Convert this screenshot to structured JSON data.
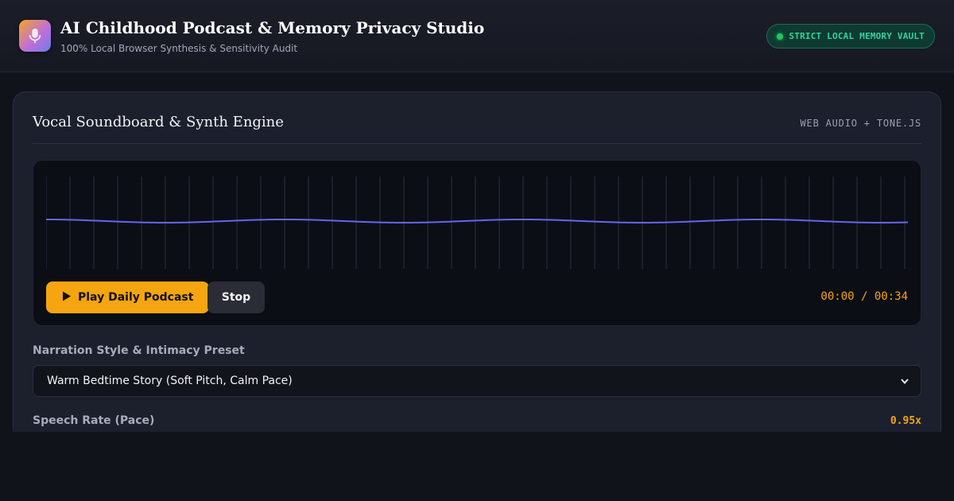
{
  "header": {
    "logo_icon": "microphone-icon",
    "title": "AI Childhood Podcast & Memory Privacy Studio",
    "subtitle": "100% Local Browser Synthesis & Sensitivity Audit",
    "badge": "STRICT LOCAL MEMORY VAULT"
  },
  "panel": {
    "title": "Vocal Soundboard & Synth Engine",
    "engine": "WEB AUDIO + TONE.JS",
    "player": {
      "play_label": "Play Daily Podcast",
      "play_icon": "play-icon",
      "stop_label": "Stop",
      "time": "00:00 / 00:34"
    },
    "style": {
      "label": "Narration Style & Intimacy Preset",
      "selected": "Warm Bedtime Story (Soft Pitch, Calm Pace)"
    },
    "rate": {
      "label": "Speech Rate (Pace)",
      "value": "0.95x"
    }
  },
  "colors": {
    "accent": "#f5a50f",
    "wave": "#6366f1",
    "vault_green": "#34d399",
    "background": "#11131b"
  }
}
